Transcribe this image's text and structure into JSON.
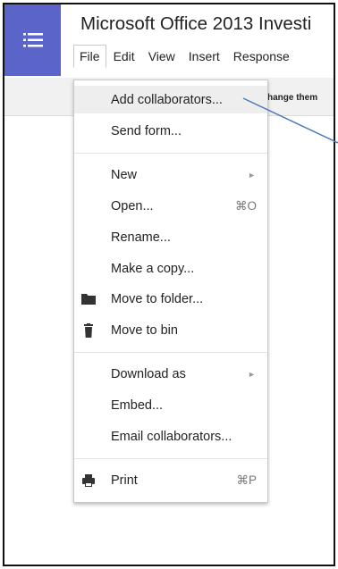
{
  "document": {
    "title": "Microsoft Office 2013 Investi"
  },
  "menubar": [
    "File",
    "Edit",
    "View",
    "Insert",
    "Response"
  ],
  "toolbar": {
    "fragment": "hange them"
  },
  "file_menu": {
    "items": [
      {
        "label": "Add collaborators...",
        "highlighted": true
      },
      {
        "label": "Send form..."
      },
      {
        "label": "New",
        "submenu": true
      },
      {
        "label": "Open...",
        "shortcut": "⌘O"
      },
      {
        "label": "Rename..."
      },
      {
        "label": "Make a copy..."
      },
      {
        "label": "Move to folder...",
        "icon": "folder-icon"
      },
      {
        "label": "Move to bin",
        "icon": "trash-icon"
      },
      {
        "label": "Download as",
        "submenu": true
      },
      {
        "label": "Embed..."
      },
      {
        "label": "Email collaborators..."
      },
      {
        "label": "Print",
        "shortcut": "⌘P",
        "icon": "printer-icon"
      }
    ],
    "submenu_glyph": "►"
  },
  "colors": {
    "app_icon_bg": "#5b64c8",
    "highlight_bg": "#eeeeee",
    "annotation_line": "#4a7bbd"
  }
}
